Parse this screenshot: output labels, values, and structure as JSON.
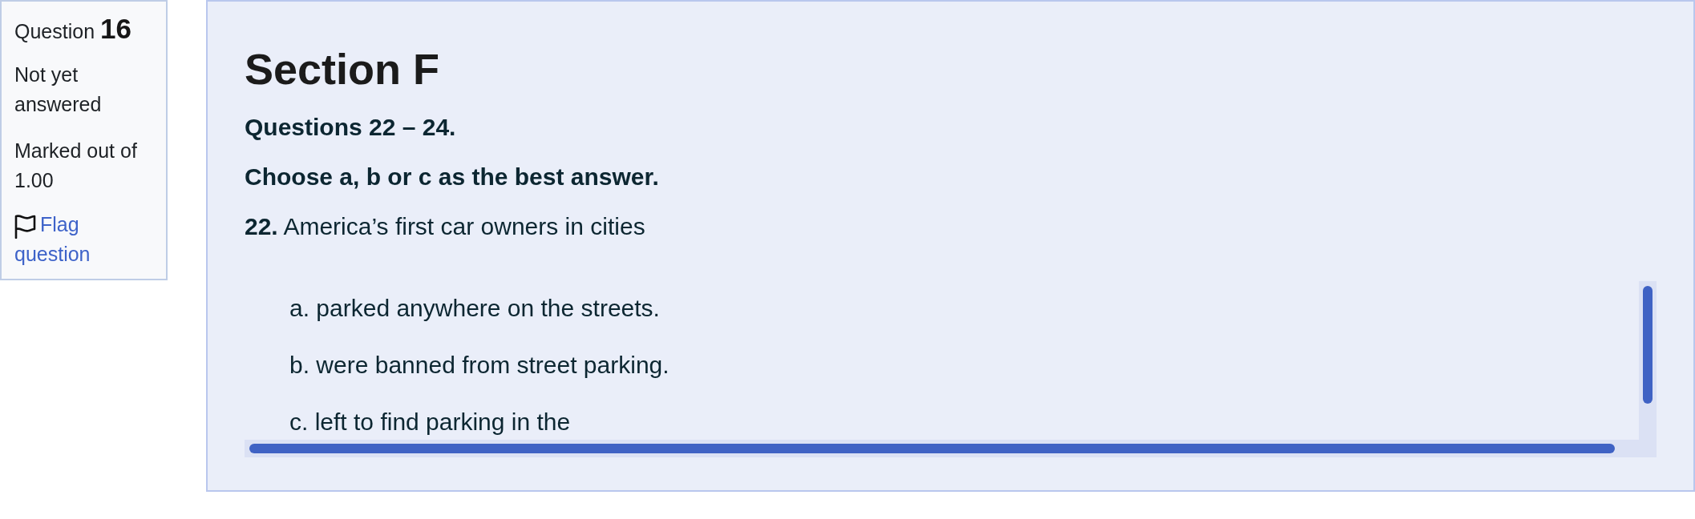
{
  "question_info": {
    "heading": "Question **16**",
    "status": "Not yet answered",
    "marks": "Marked out of 1.00",
    "flag_link": "Flag question"
  },
  "content": {
    "title": "Section F",
    "instructions": [
      "Questions 22 – 24.",
      "Choose a, b or c as the best answer."
    ],
    "question": "**22.** America’s first car owners in cities",
    "options": [
      "a. parked anywhere on the streets.",
      "b. were banned from street parking.",
      "c. left to find parking in the"
    ]
  }
}
